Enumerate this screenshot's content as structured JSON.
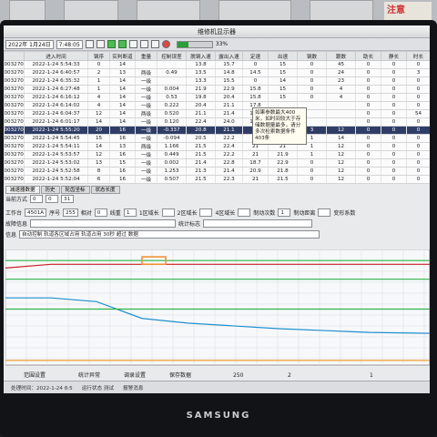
{
  "sign_text": "注意",
  "window_title": "维修机显示器",
  "toolbar": {
    "date": "2022年 1月24日",
    "time": "7:48:05",
    "progress_label": "33%",
    "progress": 0.33
  },
  "table": {
    "columns": [
      "进入时间",
      "钢序",
      "实判断道",
      "重量",
      "控制误差",
      "脱钢入速",
      "露出入速",
      "定速",
      "出速",
      "钢数",
      "跟数",
      "助长",
      "静长",
      "时长"
    ],
    "rows": [
      [
        "2022-1-24 5:54:33",
        "0",
        "14",
        "",
        "",
        "13.8",
        "15.7",
        "0",
        "15",
        "0",
        "45",
        "0",
        "0",
        "0"
      ],
      [
        "2022-1-24 6:40:57",
        "2",
        "13",
        "两级",
        "0.49",
        "13.5",
        "14.8",
        "14.5",
        "15",
        "0",
        "24",
        "0",
        "0",
        "3"
      ],
      [
        "2022-1-24 6:35:32",
        "1",
        "14",
        "一级",
        "",
        "13.3",
        "15.5",
        "0",
        "14",
        "0",
        "23",
        "0",
        "0",
        "0"
      ],
      [
        "2022-1-24 6:27:48",
        "1",
        "14",
        "一级",
        "0.004",
        "21.9",
        "22.9",
        "15.8",
        "15",
        "0",
        "4",
        "0",
        "0",
        "0"
      ],
      [
        "2022-1-24 6:16:12",
        "4",
        "14",
        "一级",
        "0.53",
        "19.8",
        "20.4",
        "15.8",
        "15",
        "0",
        "4",
        "0",
        "0",
        "0"
      ],
      [
        "2022-1-24 6:14:02",
        "4",
        "14",
        "一级",
        "0.222",
        "20.4",
        "21.1",
        "17.8",
        "",
        "",
        "",
        "0",
        "0",
        "0"
      ],
      [
        "2022-1-24 6:04:37",
        "12",
        "14",
        "两级",
        "0.520",
        "21.1",
        "21.4",
        "15.9",
        "",
        "",
        "",
        "0",
        "0",
        "54"
      ],
      [
        "2022-1-24 6:01:17",
        "14",
        "14",
        "一级",
        "0.120",
        "22.4",
        "24.0",
        "15.9",
        "",
        "",
        "",
        "0",
        "0",
        "0"
      ],
      [
        "2022-1-24 5:55:20",
        "20",
        "16",
        "一级",
        "-0.337",
        "20.8",
        "21.1",
        "17",
        "25",
        "3",
        "12",
        "0",
        "0",
        "0"
      ],
      [
        "2022-1-24 5:54:45",
        "15",
        "16",
        "一级",
        "-0.094",
        "20.5",
        "22.2",
        "21",
        "21.1",
        "1",
        "14",
        "0",
        "0",
        "0"
      ],
      [
        "2022-1-24 5:54:11",
        "14",
        "13",
        "两级",
        "1.166",
        "21.5",
        "22.4",
        "21",
        "21",
        "1",
        "12",
        "0",
        "0",
        "0"
      ],
      [
        "2022-1-24 5:53:57",
        "12",
        "16",
        "一级",
        "0.449",
        "21.5",
        "22.2",
        "21",
        "21.9",
        "1",
        "12",
        "0",
        "0",
        "0"
      ],
      [
        "2022-1-24 5:53:02",
        "13",
        "15",
        "一级",
        "0.002",
        "21.4",
        "22.8",
        "18.7",
        "22.9",
        "0",
        "12",
        "0",
        "0",
        "0"
      ],
      [
        "2022-1-24 5:52:58",
        "8",
        "16",
        "一级",
        "1.253",
        "21.3",
        "21.4",
        "20.9",
        "21.8",
        "0",
        "12",
        "0",
        "0",
        "0"
      ],
      [
        "2022-1-24 5:52:04",
        "6",
        "16",
        "一级",
        "0.507",
        "21.5",
        "22.3",
        "21",
        "21.5",
        "0",
        "12",
        "0",
        "0",
        "0"
      ]
    ],
    "row_ids": [
      "0032704",
      "0032704",
      "0032704",
      "0032704",
      "0032704",
      "0032704",
      "0032704",
      "0032704",
      "0032704",
      "0032704",
      "0032704",
      "0032704",
      "0032704",
      "0032704",
      "0032704"
    ],
    "selected_row": 8
  },
  "tooltip_text": "如果参数最大400米，如时间较大于存储数据量最多，请分多次检索数据条件403条",
  "tabs": [
    "减速器数据",
    "历史",
    "轮齿坐标",
    "状态长度"
  ],
  "summary": {
    "label": "当前方式",
    "values": [
      "0",
      "0",
      "31"
    ]
  },
  "fields": {
    "f1_label": "工作台",
    "f1_value": "4501A",
    "f2_label": "序号",
    "f2_value": "255",
    "f3_label": "相对",
    "f3_value": "0",
    "f4_label": "线重",
    "f4_value": "1",
    "f5_label": "1区域长",
    "f6_label": "2区域长",
    "f7_label": "3区域长",
    "f8_label": "4区域长",
    "f9_label": "5区域长",
    "f10_label": "制动次数",
    "f10_value": "1",
    "f11_label": "制动距离",
    "f12_label": "变形系数",
    "f13_label": "记录次数",
    "note_label": "故障信息",
    "stat_label": "统计标志",
    "info_label": "信息",
    "info_text": "自动控制 轨道各区域占用 轨道占用 30秒 超过 数据"
  },
  "chart_data": {
    "type": "line",
    "x": [
      0,
      50,
      100,
      150,
      200,
      250,
      300,
      350,
      400,
      466
    ],
    "series": [
      {
        "color": "#2bb34a",
        "values": [
          112,
          112,
          112,
          112,
          112,
          112,
          112,
          112,
          112,
          112
        ]
      },
      {
        "color": "#2bb34a",
        "values": [
          92,
          92,
          92,
          92,
          92,
          92,
          92,
          92,
          92,
          92
        ]
      },
      {
        "color": "#c9202a",
        "values": [
          104,
          108,
          108,
          108,
          108,
          108,
          108,
          108,
          108,
          108
        ]
      },
      {
        "color": "#1f8fd0",
        "values": [
          72,
          72,
          68,
          50,
          45,
          42,
          39,
          37,
          35,
          34
        ]
      },
      {
        "color": "#2bb34a",
        "values": [
          60,
          60,
          60,
          60,
          60,
          60,
          60,
          60,
          60,
          60
        ]
      },
      {
        "color": "#f0a030",
        "values": [
          5,
          5,
          5,
          5,
          5,
          5,
          5,
          5,
          5,
          5
        ]
      }
    ],
    "highlight": {
      "x": [
        150,
        176
      ],
      "y": [
        108,
        116
      ],
      "color": "#f28c2a"
    },
    "grid": true,
    "xlim": [
      0,
      466
    ],
    "ylim": [
      0,
      120
    ]
  },
  "nav": {
    "range_label": "范围设置",
    "stat_label": "统计异常",
    "record_label": "调录设置",
    "save_label": "保存数据",
    "zoom": "250",
    "page_value": "2",
    "step": "1"
  },
  "status": {
    "user": "处理时间：2022-1-24 8:5",
    "mode": "运行状态 测试",
    "alarm": "报警消息"
  },
  "brand": "SAMSUNG"
}
